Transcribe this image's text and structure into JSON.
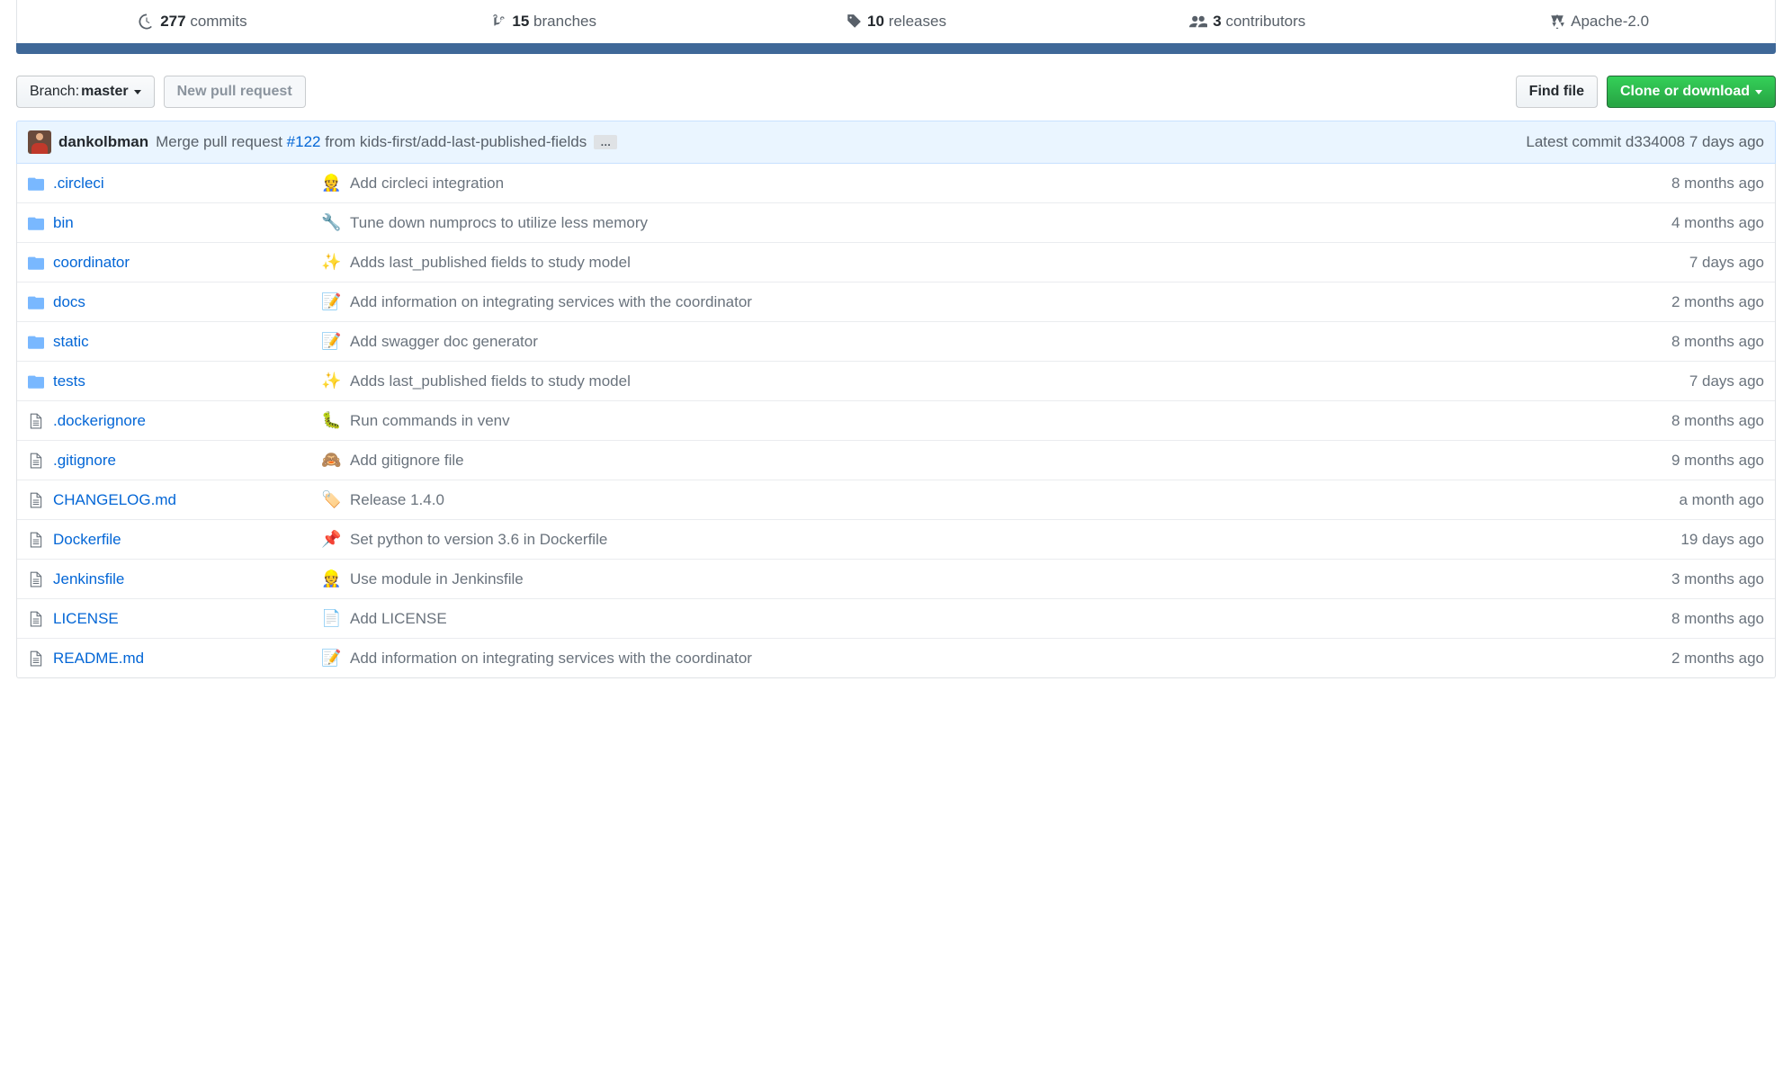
{
  "stats": {
    "commits": {
      "count": "277",
      "label": "commits"
    },
    "branches": {
      "count": "15",
      "label": "branches"
    },
    "releases": {
      "count": "10",
      "label": "releases"
    },
    "contributors": {
      "count": "3",
      "label": "contributors"
    },
    "license": {
      "name": "Apache-2.0"
    }
  },
  "actions": {
    "branch_prefix": "Branch:",
    "branch_name": "master",
    "new_pr": "New pull request",
    "find_file": "Find file",
    "clone": "Clone or download"
  },
  "latest_commit": {
    "author": "dankolbman",
    "message_prefix": "Merge pull request ",
    "pr_link": "#122",
    "message_suffix": " from kids-first/add-last-published-fields",
    "meta_prefix": "Latest commit ",
    "sha": "d334008",
    "time": " 7 days ago"
  },
  "files": [
    {
      "type": "dir",
      "name": ".circleci",
      "emoji": "👷",
      "msg": "Add circleci integration",
      "time": "8 months ago"
    },
    {
      "type": "dir",
      "name": "bin",
      "emoji": "🔧",
      "msg": "Tune down numprocs to utilize less memory",
      "time": "4 months ago"
    },
    {
      "type": "dir",
      "name": "coordinator",
      "emoji": "✨",
      "msg": "Adds last_published fields to study model",
      "time": "7 days ago"
    },
    {
      "type": "dir",
      "name": "docs",
      "emoji": "📝",
      "msg": "Add information on integrating services with the coordinator",
      "time": "2 months ago"
    },
    {
      "type": "dir",
      "name": "static",
      "emoji": "📝",
      "msg": "Add swagger doc generator",
      "time": "8 months ago"
    },
    {
      "type": "dir",
      "name": "tests",
      "emoji": "✨",
      "msg": "Adds last_published fields to study model",
      "time": "7 days ago"
    },
    {
      "type": "file",
      "name": ".dockerignore",
      "emoji": "🐛",
      "msg": "Run commands in venv",
      "time": "8 months ago"
    },
    {
      "type": "file",
      "name": ".gitignore",
      "emoji": "🙈",
      "msg": "Add gitignore file",
      "time": "9 months ago"
    },
    {
      "type": "file",
      "name": "CHANGELOG.md",
      "emoji": "🏷️",
      "msg": "Release 1.4.0",
      "time": "a month ago"
    },
    {
      "type": "file",
      "name": "Dockerfile",
      "emoji": "📌",
      "msg": "Set python to version 3.6 in Dockerfile",
      "time": "19 days ago"
    },
    {
      "type": "file",
      "name": "Jenkinsfile",
      "emoji": "👷",
      "msg": "Use module in Jenkinsfile",
      "time": "3 months ago"
    },
    {
      "type": "file",
      "name": "LICENSE",
      "emoji": "📄",
      "msg": "Add LICENSE",
      "time": "8 months ago"
    },
    {
      "type": "file",
      "name": "README.md",
      "emoji": "📝",
      "msg": "Add information on integrating services with the coordinator",
      "time": "2 months ago"
    }
  ],
  "icons": {
    "folder_color": "#79b8ff",
    "file_color": "#6a737d"
  }
}
